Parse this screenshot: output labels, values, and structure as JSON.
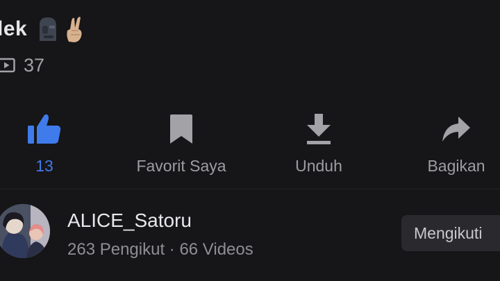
{
  "video": {
    "title_fragment": "lek",
    "views": "37"
  },
  "actions": [
    {
      "label": "13",
      "icon": "thumbs-up-icon",
      "active": true
    },
    {
      "label": "Favorit Saya",
      "icon": "bookmark-icon"
    },
    {
      "label": "Unduh",
      "icon": "download-icon"
    },
    {
      "label": "Bagikan",
      "icon": "share-icon"
    }
  ],
  "channel": {
    "name": "ALICE_Satoru",
    "stats": "263 Pengikut · 66 Videos",
    "follow_label": "Mengikuti"
  },
  "colors": {
    "background": "#161517",
    "accent": "#3f7bea",
    "icon_muted": "#9e9da2",
    "button_bg": "#2a292d"
  }
}
